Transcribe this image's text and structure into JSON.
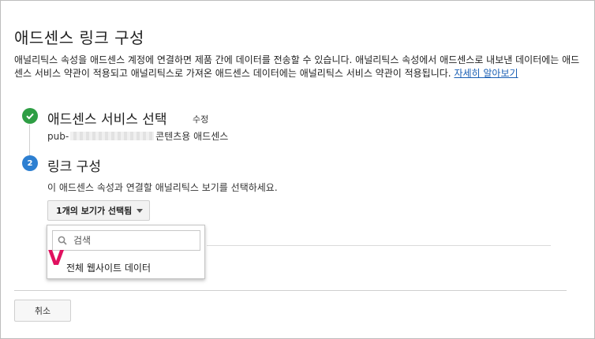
{
  "page": {
    "title": "애드센스 링크 구성",
    "description": "애널리틱스 속성을 애드센스 계정에 연결하면 제품 간에 데이터를 전송할 수 있습니다. 애널리틱스 속성에서 애드센스로 내보낸 데이터에는 애드센스 서비스 약관이 적용되고 애널리틱스로 가져온 애드센스 데이터에는 애널리틱스 서비스 약관이 적용됩니다. ",
    "learn_more": "자세히 알아보기"
  },
  "step1": {
    "title": "애드센스 서비스 선택",
    "edit_label": "수정",
    "pub_prefix": "pub-",
    "pub_suffix": "콘텐츠용 애드센스"
  },
  "step2": {
    "number": "2",
    "title": "링크 구성",
    "description": "이 애드센스 속성과 연결할 애널리틱스 보기를 선택하세요.",
    "dropdown_label": "1개의 보기가 선택됨"
  },
  "popup": {
    "search_placeholder": "검색",
    "option_label": "전체 웹사이트 데이터"
  },
  "annotation": {
    "mark": "V",
    "color": "#e0115f"
  },
  "footer": {
    "cancel_label": "취소"
  },
  "colors": {
    "check_green": "#2e9e44",
    "step_blue": "#2d7fd1",
    "link_blue": "#1a5fb4"
  },
  "icons": {
    "step1": "check-icon",
    "search": "search-icon",
    "dropdown": "caret-down-icon"
  }
}
